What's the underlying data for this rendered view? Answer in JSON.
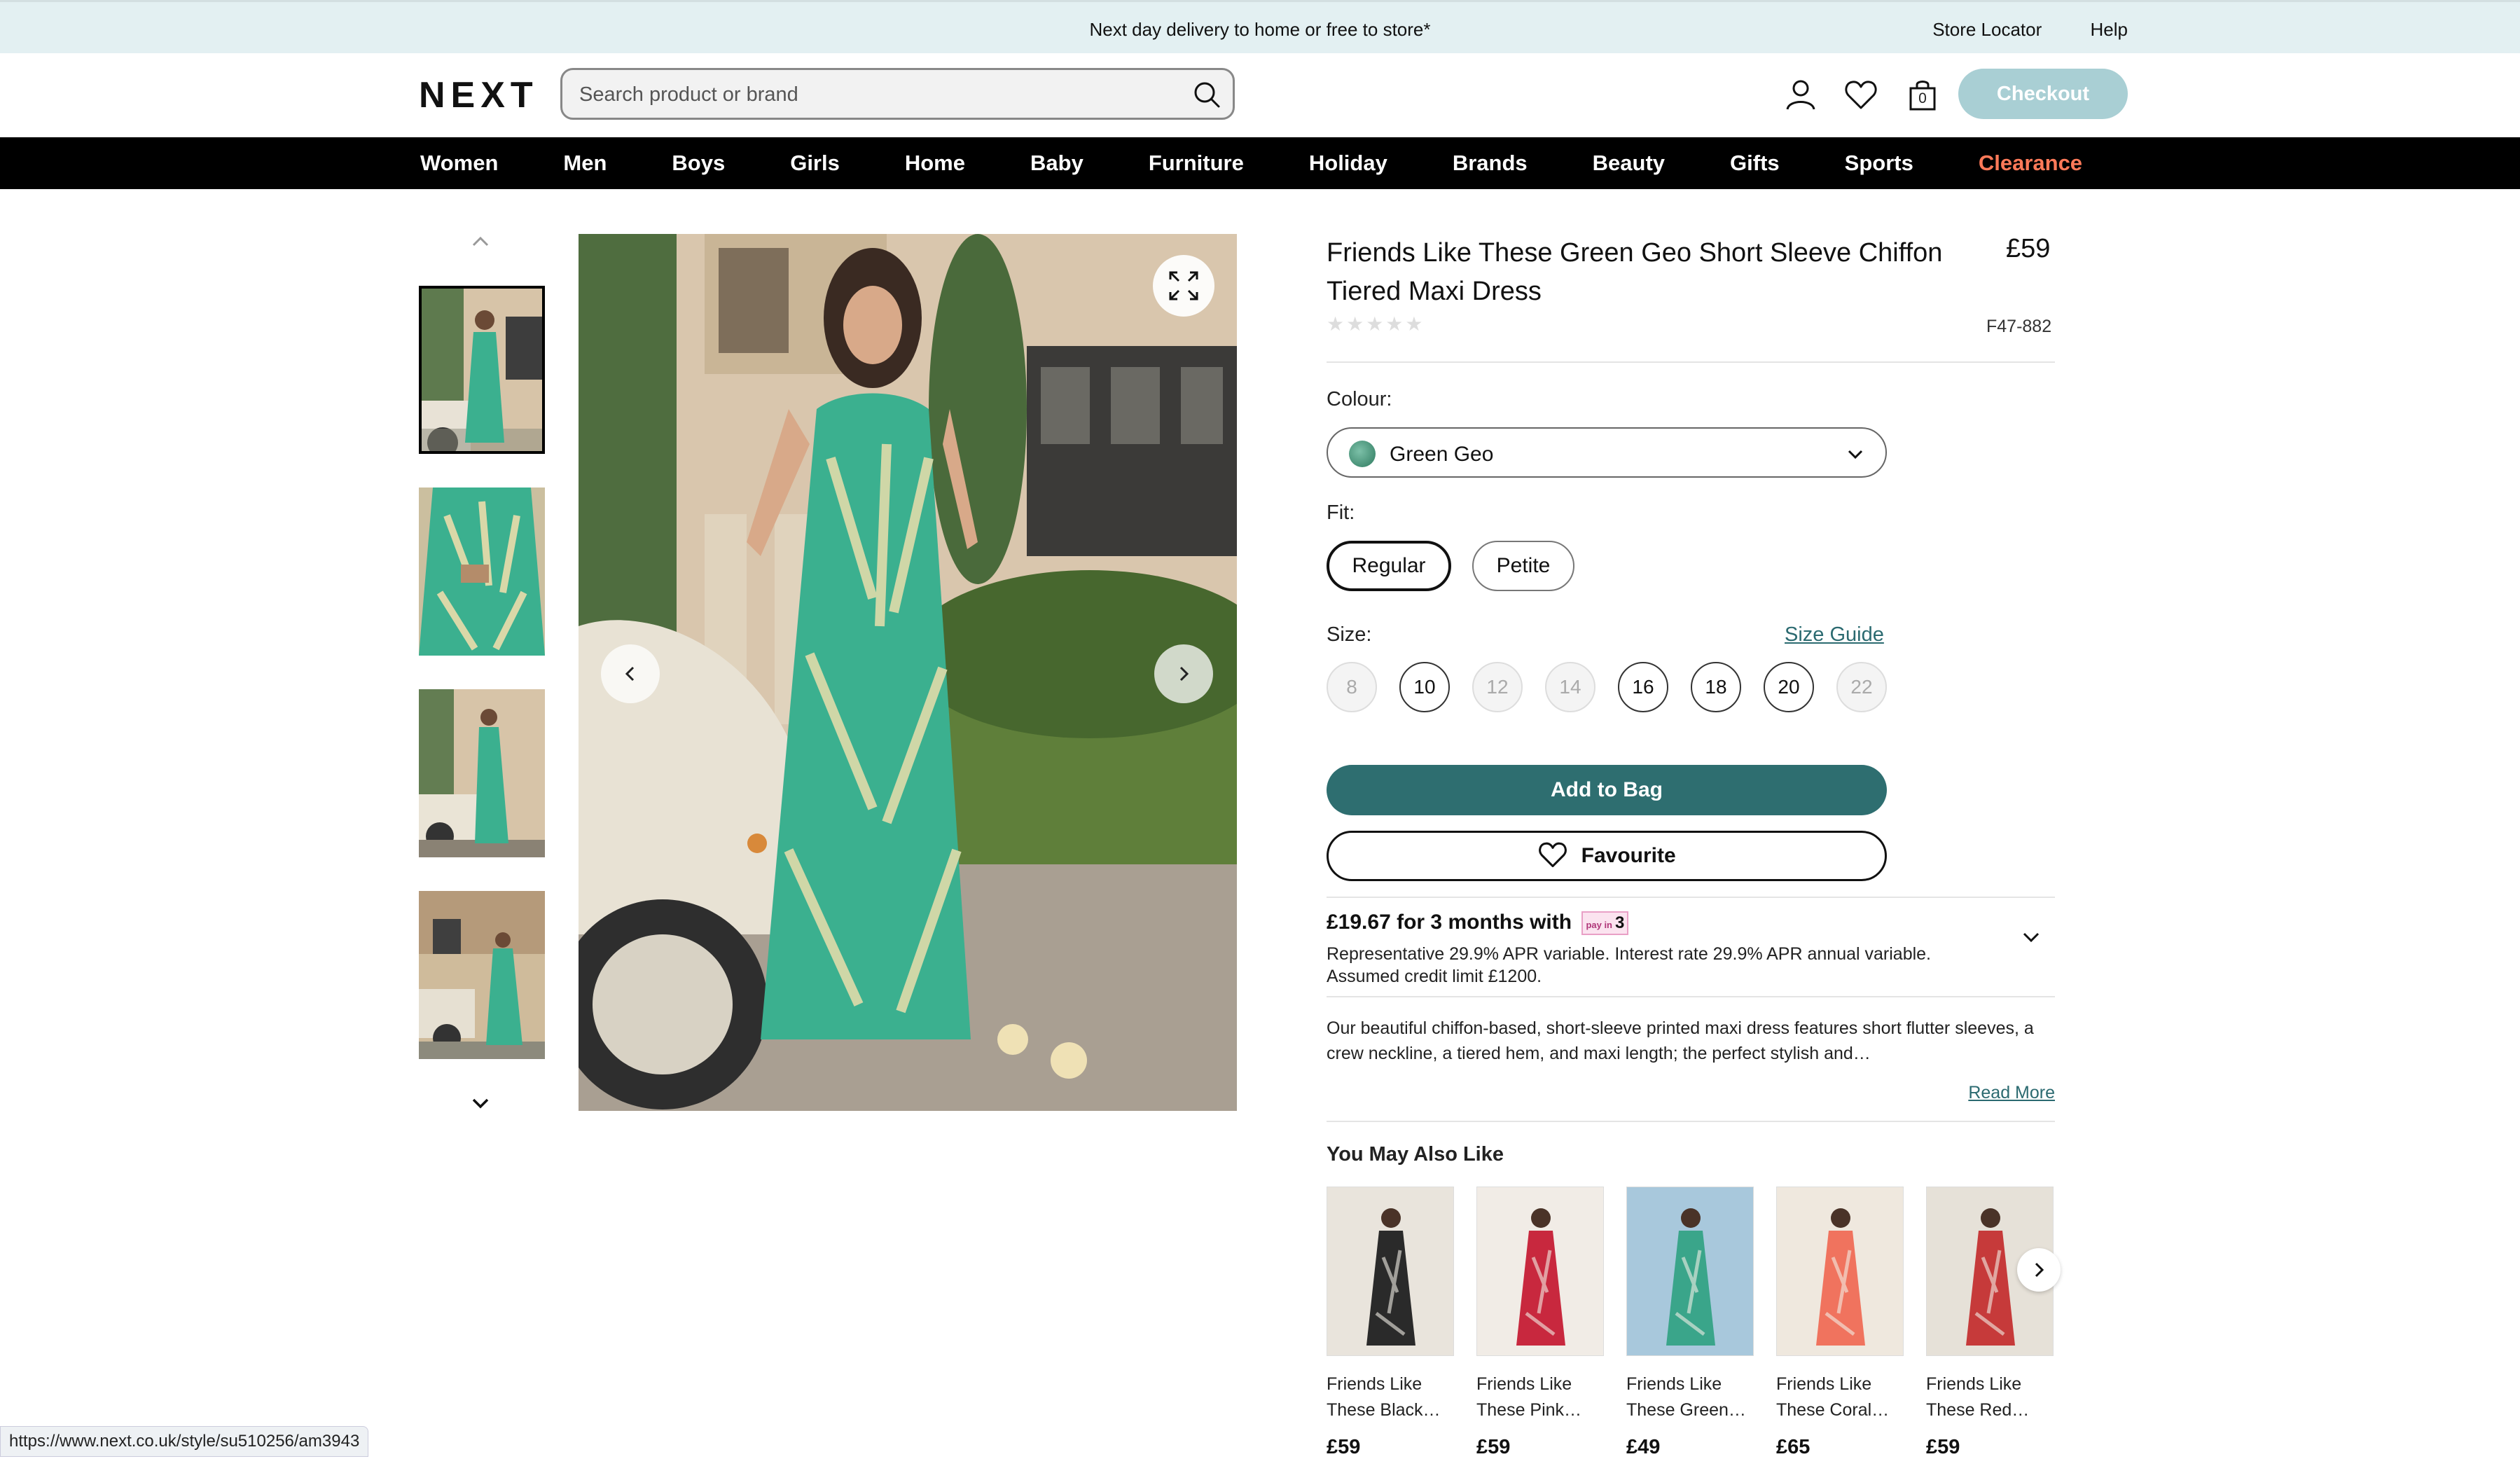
{
  "topbar": {
    "promo": "Next day delivery to home or free to store*",
    "store_locator": "Store Locator",
    "help": "Help"
  },
  "header": {
    "logo": "NEXT",
    "search_placeholder": "Search product or brand",
    "bag_count": "0",
    "checkout": "Checkout"
  },
  "nav": [
    "Women",
    "Men",
    "Boys",
    "Girls",
    "Home",
    "Baby",
    "Furniture",
    "Holiday",
    "Brands",
    "Beauty",
    "Gifts",
    "Sports",
    "Clearance"
  ],
  "product": {
    "title": "Friends Like These Green Geo Short Sleeve Chiffon Tiered Maxi Dress",
    "price": "£59",
    "stars": "★★★★★",
    "sku": "F47-882",
    "colour_label": "Colour:",
    "colour_value": "Green Geo",
    "fit_label": "Fit:",
    "fit_options": [
      "Regular",
      "Petite"
    ],
    "size_label": "Size:",
    "size_guide": "Size Guide",
    "sizes": [
      {
        "label": "8",
        "available": false
      },
      {
        "label": "10",
        "available": true
      },
      {
        "label": "12",
        "available": false
      },
      {
        "label": "14",
        "available": false
      },
      {
        "label": "16",
        "available": true
      },
      {
        "label": "18",
        "available": true
      },
      {
        "label": "20",
        "available": true
      },
      {
        "label": "22",
        "available": false
      }
    ],
    "add_to_bag": "Add to Bag",
    "favourite": "Favourite",
    "payin_text": "£19.67 for 3 months with",
    "payin_logo_small": "pay in",
    "payin_logo_number": "3",
    "apr_text": "Representative 29.9% APR variable. Interest rate 29.9% APR annual variable. Assumed credit limit £1200.",
    "description": "Our beautiful chiffon-based, short-sleeve printed maxi dress features short flutter sleeves, a crew neckline, a tiered hem, and maxi length; the perfect stylish and…",
    "read_more": "Read More"
  },
  "you_may_also_like": {
    "title": "You May Also Like",
    "items": [
      {
        "name_line1": "Friends Like",
        "name_line2": "These Black…",
        "price": "£59",
        "dress_color": "#2a2a2a",
        "bg": "#e9e4dc"
      },
      {
        "name_line1": "Friends Like",
        "name_line2": "These Pink…",
        "price": "£59",
        "dress_color": "#c8283e",
        "bg": "#f1ece6"
      },
      {
        "name_line1": "Friends Like",
        "name_line2": "These Green…",
        "price": "£49",
        "dress_color": "#3aa58a",
        "bg": "#a8c8dc"
      },
      {
        "name_line1": "Friends Like",
        "name_line2": "These Coral…",
        "price": "£65",
        "dress_color": "#f0735e",
        "bg": "#efe8de"
      },
      {
        "name_line1": "Friends Like",
        "name_line2": "These Red…",
        "price": "£59",
        "dress_color": "#c63a3a",
        "bg": "#e6e1d8"
      }
    ]
  },
  "status_url": "https://www.next.co.uk/style/su510256/am3943",
  "colors": {
    "accent": "#2e6e70",
    "checkout": "#a9cfd4",
    "clearance": "#ff7a59",
    "dress": "#3bb08f"
  }
}
